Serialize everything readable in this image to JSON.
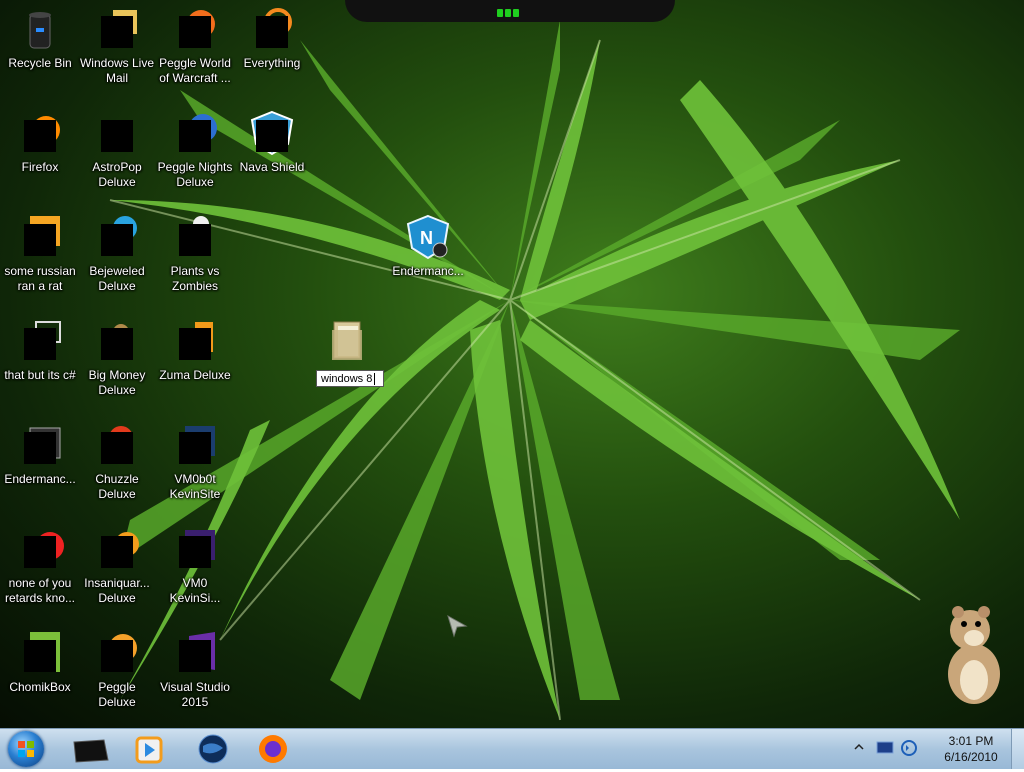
{
  "desktop": {
    "icons": [
      {
        "label": "Recycle Bin",
        "icon": "recycle-bin-icon"
      },
      {
        "label": "Windows Live Mail",
        "icon": "windows-live-mail-icon"
      },
      {
        "label": "Peggle World of Warcraft ...",
        "icon": "peggle-wow-icon"
      },
      {
        "label": "Everything",
        "icon": "everything-search-icon"
      },
      {
        "label": "Firefox",
        "icon": "firefox-icon"
      },
      {
        "label": "AstroPop Deluxe",
        "icon": "astropop-icon"
      },
      {
        "label": "Peggle Nights Deluxe",
        "icon": "peggle-nights-icon"
      },
      {
        "label": "Nava Shield",
        "icon": "nava-shield-icon"
      },
      {
        "label": "some russian ran a rat",
        "icon": "sublime-text-icon"
      },
      {
        "label": "Bejeweled Deluxe",
        "icon": "bejeweled-icon"
      },
      {
        "label": "Plants vs Zombies",
        "icon": "plants-vs-zombies-icon"
      },
      {
        "label": "that but its c#",
        "icon": "copy-files-icon"
      },
      {
        "label": "Big Money Deluxe",
        "icon": "big-money-icon"
      },
      {
        "label": "Zuma Deluxe",
        "icon": "zuma-icon"
      },
      {
        "label": "Endermanc...",
        "icon": "terminal-icon"
      },
      {
        "label": "Chuzzle Deluxe",
        "icon": "chuzzle-icon"
      },
      {
        "label": "VM0b0t KevinSite",
        "icon": "vm-kevinsite-icon"
      },
      {
        "label": "none of you retards kno...",
        "icon": "red-app-icon"
      },
      {
        "label": "Insaniquar... Deluxe",
        "icon": "insaniquarium-icon"
      },
      {
        "label": "VM0 KevinSi...",
        "icon": "vm-kevinsite-icon"
      },
      {
        "label": "ChomikBox",
        "icon": "chomikbox-icon"
      },
      {
        "label": "Peggle Deluxe",
        "icon": "peggle-icon"
      },
      {
        "label": "Visual Studio 2015",
        "icon": "visual-studio-icon"
      },
      {
        "label": "Endermanc...",
        "icon": "nava-shield-icon"
      }
    ],
    "rename_value": "windows 8"
  },
  "taskbar": {
    "pinned": [
      "black-window-icon",
      "media-player-icon",
      "globe-icon",
      "firefox-icon"
    ],
    "clock_time": "3:01 PM",
    "clock_date": "6/16/2010"
  },
  "colors": {
    "taskbar": "#a9c5de",
    "accent": "#2a7fd1"
  }
}
